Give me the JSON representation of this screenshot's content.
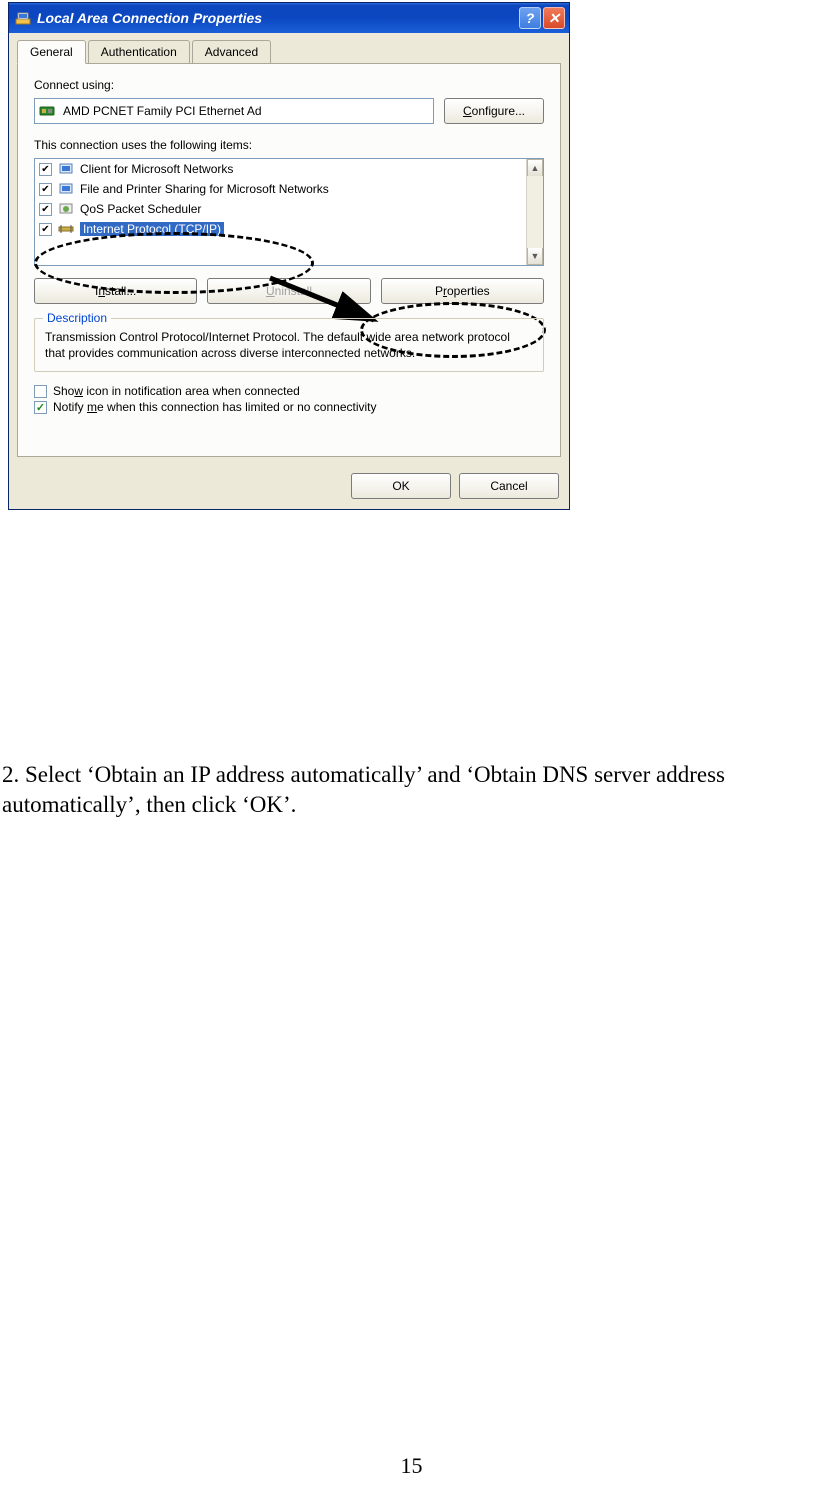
{
  "window": {
    "title": "Local Area Connection Properties"
  },
  "tabs": {
    "general": "General",
    "authentication": "Authentication",
    "advanced": "Advanced"
  },
  "connect_using_label": "Connect using:",
  "adapter_name": "AMD PCNET Family PCI Ethernet Ad",
  "configure_btn": "Configure...",
  "items_label": "This connection uses the following items:",
  "items": [
    {
      "label": "Client for Microsoft Networks",
      "checked": true,
      "selected": false
    },
    {
      "label": "File and Printer Sharing for Microsoft Networks",
      "checked": true,
      "selected": false
    },
    {
      "label": "QoS Packet Scheduler",
      "checked": true,
      "selected": false
    },
    {
      "label": "Internet Protocol (TCP/IP)",
      "checked": true,
      "selected": true
    }
  ],
  "install_btn": "Install...",
  "uninstall_btn": "Uninstall",
  "properties_btn": "Properties",
  "description": {
    "legend": "Description",
    "text": "Transmission Control Protocol/Internet Protocol. The default wide area network protocol that provides communication across diverse interconnected networks."
  },
  "show_icon": {
    "label": "Show icon in notification area when connected",
    "checked": false
  },
  "notify": {
    "label": "Notify me when this connection has limited or no connectivity",
    "checked": true
  },
  "ok_btn": "OK",
  "cancel_btn": "Cancel",
  "instruction_text": "2. Select ‘Obtain an IP address automatically’ and ‘Obtain DNS server address automatically’, then click ‘OK’.",
  "page_number": "15"
}
